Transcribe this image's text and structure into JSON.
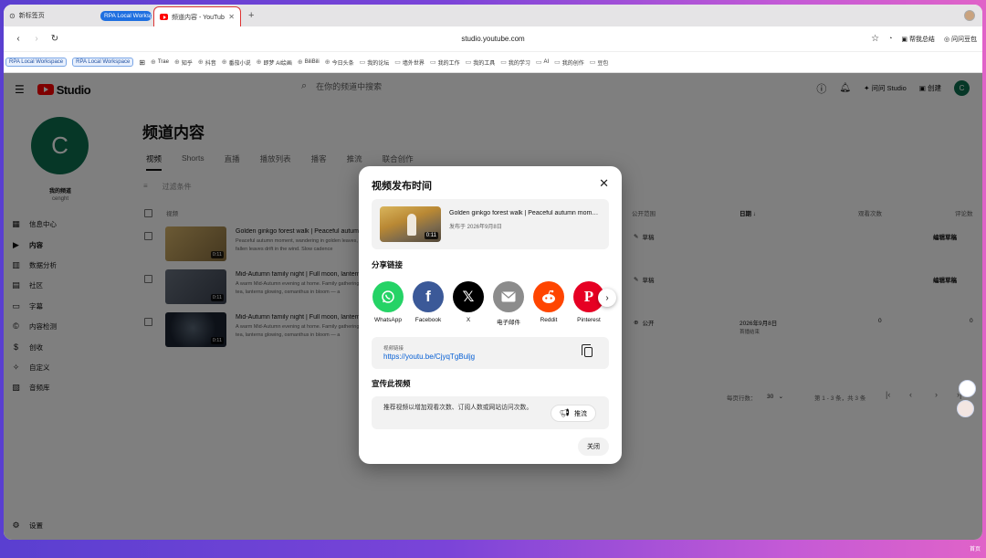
{
  "browser": {
    "tabs": [
      {
        "label": "新标签页"
      },
      {
        "label": "频道内容 - YouTube Studio"
      }
    ],
    "tab_group": "RPA Local Workspace",
    "new_tab": "+",
    "url": "studio.youtube.com",
    "right_actions": [
      "帮我总结",
      "问问豆包"
    ],
    "bookmarks": {
      "chips": [
        "RPA Local Workspace",
        "RPA Local Workspace"
      ],
      "items": [
        "Trae",
        "知乎",
        "抖音",
        "番茄小说",
        "即梦 AI绘画",
        "BiliBili",
        "今日头条",
        "我的论坛",
        "墙外世界",
        "我的工作",
        "我的工具",
        "我的学习",
        "AI",
        "我的创作",
        "豆包"
      ]
    }
  },
  "studio": {
    "logo": "Studio",
    "search_placeholder": "在你的频道中搜索",
    "ask_studio": "问问 Studio",
    "create": "创建",
    "avatar_letter": "C",
    "channel": {
      "label": "我的频道",
      "name": "cenght"
    },
    "nav": [
      "信息中心",
      "内容",
      "数据分析",
      "社区",
      "字幕",
      "内容检测",
      "创收",
      "自定义",
      "音频库"
    ],
    "settings": "设置",
    "page_title": "频道内容",
    "tabs": [
      "视频",
      "Shorts",
      "直播",
      "播放列表",
      "播客",
      "推流",
      "联合创作"
    ],
    "filter": "过滤条件",
    "columns": {
      "video": "视频",
      "visibility": "公开范围",
      "date": "日期",
      "views": "观看次数",
      "comments": "评论数"
    },
    "rows": [
      {
        "title": "Golden ginkgo forest walk | Peaceful autumn",
        "desc": "Peaceful autumn moment, wandering in golden leaves, fallen leaves drift in the wind. Slow cadence",
        "duration": "0:11",
        "visibility": "草稿",
        "action": "编辑草稿"
      },
      {
        "title": "Mid-Autumn family night | Full moon, lantern",
        "desc": "A warm Mid-Autumn evening at home. Family gathering, tea, lanterns glowing, osmanthus in bloom — a",
        "duration": "0:11",
        "visibility": "草稿",
        "action": "编辑草稿"
      },
      {
        "title": "Mid-Autumn family night | Full moon, lantern",
        "desc": "A warm Mid-Autumn evening at home. Family gathering, tea, lanterns glowing, osmanthus in bloom — a",
        "duration": "0:11",
        "visibility": "公开",
        "date": "2026年9月8日",
        "date_sub": "首播结束",
        "views": "0",
        "comments": "0"
      }
    ],
    "pagination": {
      "rows_per_page": "每页行数：",
      "count": "30",
      "range": "第 1 - 3 条，共 3 条"
    }
  },
  "modal": {
    "title": "视频发布时间",
    "video_title": "Golden ginkgo forest walk | Peaceful autumn moment",
    "published": "发布于 2026年9月8日",
    "duration": "0:11",
    "share_heading": "分享链接",
    "share": [
      {
        "label": "WhatsApp",
        "icon": "whatsapp-icon",
        "color": "#25d366"
      },
      {
        "label": "Facebook",
        "icon": "facebook-icon",
        "color": "#3b5998"
      },
      {
        "label": "X",
        "icon": "x-icon",
        "color": "#000000"
      },
      {
        "label": "电子邮件",
        "icon": "mail-icon",
        "color": "#8c8c8c"
      },
      {
        "label": "Reddit",
        "icon": "reddit-icon",
        "color": "#ff4500"
      },
      {
        "label": "Pinterest",
        "icon": "pinterest-icon",
        "color": "#e60023"
      }
    ],
    "link_label": "视频链接",
    "link": "https://youtu.be/CjyqTgBuljg",
    "promote_heading": "宣传此视频",
    "promote_text": "推荐视频以增加观看次数、订阅人数或网站访问次数。",
    "promote_button": "推流",
    "close_button": "关闭"
  },
  "desktop_corner": "首页"
}
